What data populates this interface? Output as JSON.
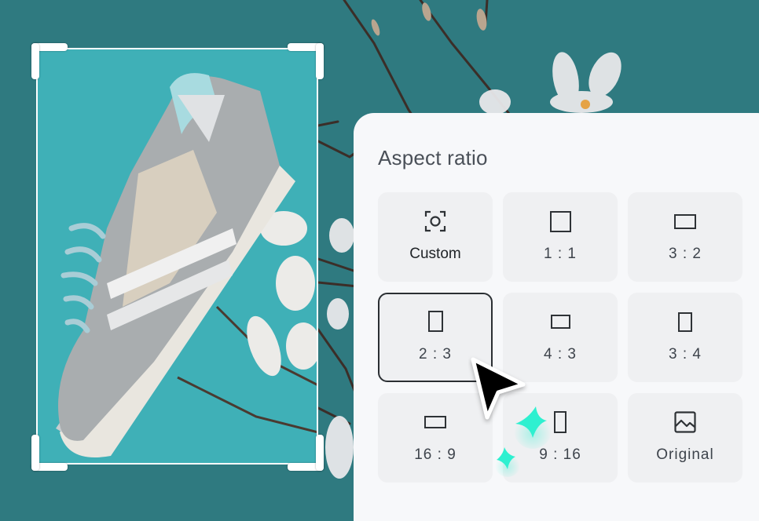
{
  "canvas": {
    "background_color": "#2f7a80",
    "crop_area_color": "#3fb0b7",
    "image_subject": "Grey sneaker with magnolia branch"
  },
  "panel": {
    "title": "Aspect ratio",
    "options": [
      {
        "label": "Custom",
        "icon": "focus-frame-icon",
        "selected": false
      },
      {
        "label": "1 : 1",
        "icon": "square-icon",
        "selected": false
      },
      {
        "label": "3 : 2",
        "icon": "landscape-rect-icon",
        "selected": false
      },
      {
        "label": "2 : 3",
        "icon": "portrait-rect-icon",
        "selected": true
      },
      {
        "label": "4 : 3",
        "icon": "landscape-rect-icon",
        "selected": false
      },
      {
        "label": "3 : 4",
        "icon": "portrait-rect-icon",
        "selected": false
      },
      {
        "label": "16 : 9",
        "icon": "wide-rect-icon",
        "selected": false
      },
      {
        "label": "9 : 16",
        "icon": "tall-rect-icon",
        "selected": false
      },
      {
        "label": "Original",
        "icon": "image-icon",
        "selected": false
      }
    ]
  },
  "accents": {
    "sparkle_color": "#2ef0d0",
    "selected_border": "#2b2f33"
  }
}
